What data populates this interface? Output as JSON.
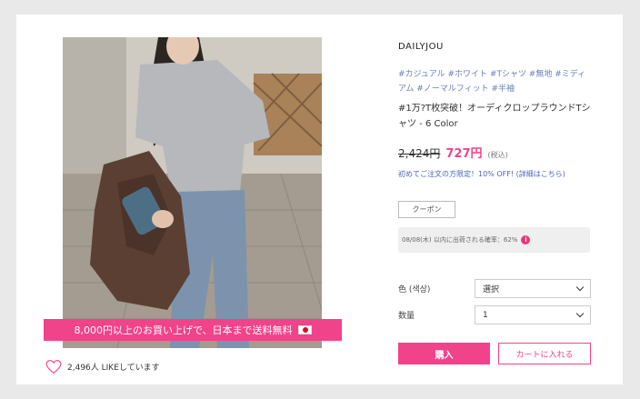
{
  "promo": {
    "text": "8,000円以上のお買い上げで、日本まで送料無料"
  },
  "likes": {
    "count_text": "2,496人 LIKEしています"
  },
  "product": {
    "brand": "DAILYJOU",
    "tags": "#カジュアル #ホワイト #Tシャツ #無地 #ミディアム #ノーマルフィット #半袖",
    "title": "#1万?T枚突破！オーディクロップラウンドTシャツ - 6 Color",
    "price_old": "2,424円",
    "price_new": "727円",
    "price_tax": "(税込)",
    "coupon_note": "初めてご注文の方限定！10% OFF! (詳細はこちら)",
    "coupon_button": "クーポン",
    "shipping_note": "08/08(木) 以内に出荷される確率：62%",
    "info_icon": "info-icon"
  },
  "options": [
    {
      "label": "色 (색상)",
      "value": "選択"
    },
    {
      "label": "数量",
      "value": "1"
    }
  ],
  "actions": {
    "buy": "購入",
    "cart": "カートに入れる"
  },
  "colors": {
    "accent": "#f0438a",
    "link": "#4a67b4",
    "tag": "#6a7fb5"
  }
}
